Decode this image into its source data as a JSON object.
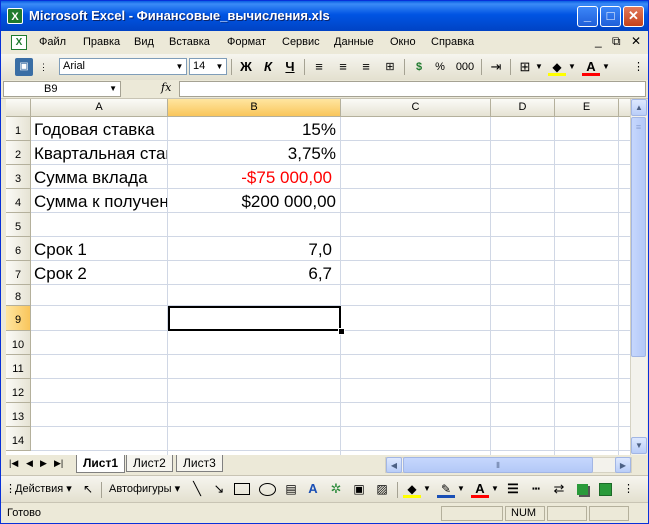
{
  "window": {
    "title": "Microsoft Excel - Финансовые_вычисления.xls"
  },
  "menu": [
    "Файл",
    "Правка",
    "Вид",
    "Вставка",
    "Формат",
    "Сервис",
    "Данные",
    "Окно",
    "Справка"
  ],
  "formatting": {
    "font": "Arial",
    "size": "14",
    "bold": "Ж",
    "italic": "К",
    "underline": "Ч",
    "percent": "%",
    "thousands": "000"
  },
  "formula_bar": {
    "name_box": "B9",
    "fx": "fx",
    "value": ""
  },
  "columns": [
    "A",
    "B",
    "C",
    "D",
    "E"
  ],
  "rows": [
    "1",
    "2",
    "3",
    "4",
    "5",
    "6",
    "7",
    "8",
    "9",
    "10",
    "11",
    "12",
    "13",
    "14"
  ],
  "cells": {
    "A1": "Годовая ставка",
    "B1": "15%",
    "A2": "Квартальная ставка",
    "B2": "3,75%",
    "A3": "Сумма вклада",
    "B3": "-$75 000,00",
    "A4": "Сумма к получению",
    "B4": "$200 000,00",
    "A6": "Срок 1",
    "B6": "7,0",
    "A7": "Срок 2",
    "B7": "6,7"
  },
  "sheets": [
    "Лист1",
    "Лист2",
    "Лист3"
  ],
  "drawing": {
    "actions": "Действия",
    "autoshapes": "Автофигуры"
  },
  "status": {
    "text": "Готово",
    "num": "NUM"
  },
  "colors": {
    "negative": "#ff0000",
    "selection_header": "#f9c55b"
  }
}
